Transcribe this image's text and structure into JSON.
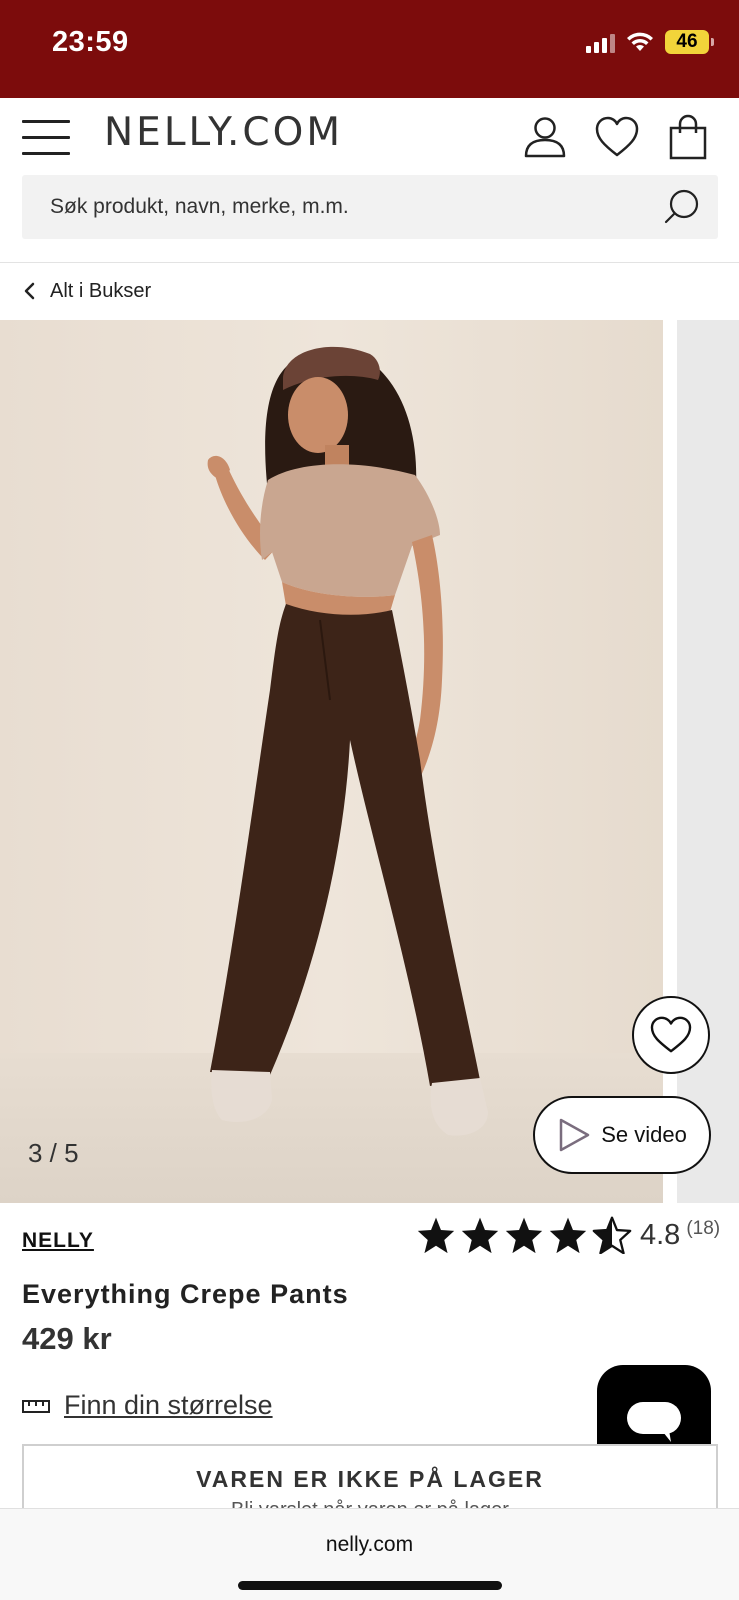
{
  "status_bar": {
    "time": "23:59",
    "battery": "46",
    "color": "#7c0c0c"
  },
  "header": {
    "logo": "NELLY.COM",
    "search": {
      "placeholder": "Søk produkt, navn, merke, m.m."
    }
  },
  "breadcrumb": {
    "label": "Alt i Bukser"
  },
  "gallery": {
    "counter": "3 / 5",
    "video_label": "Se video"
  },
  "product": {
    "brand": "NELLY",
    "rating": {
      "value": "4.8",
      "count": "(18)",
      "stars": 4.5
    },
    "name": "Everything Crepe Pants",
    "price": "429 kr",
    "size_guide_label": "Finn din størrelse",
    "stock": {
      "title": "VAREN ER IKKE PÅ LAGER",
      "subtitle": "Bli varslet når varen er på lager"
    }
  },
  "browser": {
    "url": "nelly.com"
  }
}
